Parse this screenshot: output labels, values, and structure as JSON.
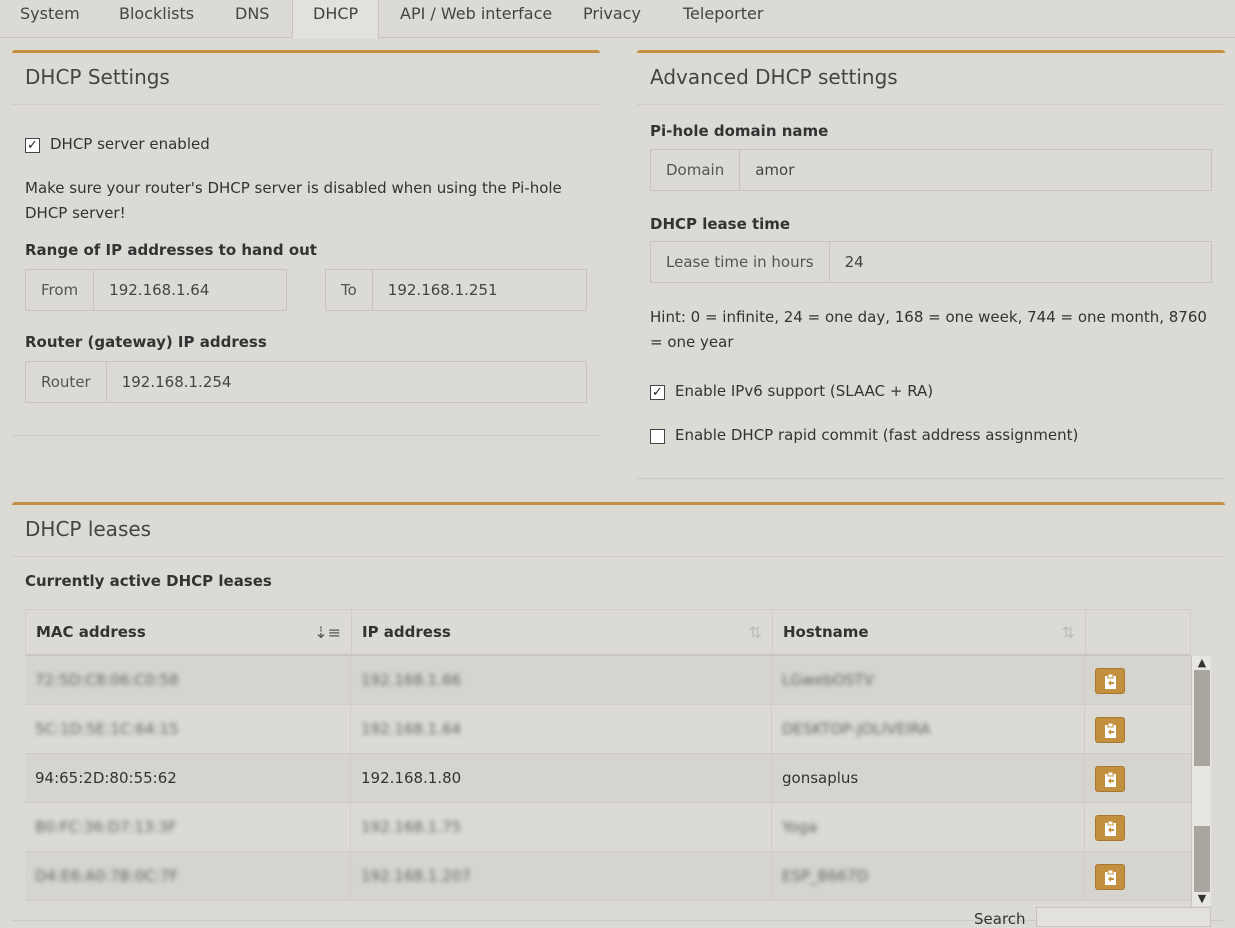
{
  "tabs": [
    "System",
    "Blocklists",
    "DNS",
    "DHCP",
    "API / Web interface",
    "Privacy",
    "Teleporter"
  ],
  "active_tab": "DHCP",
  "dhcp_settings": {
    "title": "DHCP Settings",
    "enabled_label": "DHCP server enabled",
    "enabled": true,
    "warning": "Make sure your router's DHCP server is disabled when using the Pi-hole DHCP server!",
    "range_label": "Range of IP addresses to hand out",
    "from_addon": "From",
    "from_value": "192.168.1.64",
    "to_addon": "To",
    "to_value": "192.168.1.251",
    "router_label": "Router (gateway) IP address",
    "router_addon": "Router",
    "router_value": "192.168.1.254"
  },
  "advanced": {
    "title": "Advanced DHCP settings",
    "domain_label": "Pi-hole domain name",
    "domain_addon": "Domain",
    "domain_value": "amor",
    "lease_label": "DHCP lease time",
    "lease_addon": "Lease time in hours",
    "lease_value": "24",
    "hint": "Hint: 0 = infinite, 24 = one day, 168 = one week, 744 = one month, 8760 = one year",
    "ipv6_label": "Enable IPv6 support (SLAAC + RA)",
    "ipv6_checked": true,
    "rapid_label": "Enable DHCP rapid commit (fast address assignment)",
    "rapid_checked": false
  },
  "leases": {
    "title": "DHCP leases",
    "subtitle": "Currently active DHCP leases",
    "columns": [
      "MAC address",
      "IP address",
      "Hostname"
    ],
    "rows": [
      {
        "mac": "72:5D:C8:06:C0:58",
        "ip": "192.168.1.66",
        "host": "LGwebOSTV",
        "blurred": true
      },
      {
        "mac": "5C:1D:5E:1C:64:15",
        "ip": "192.168.1.64",
        "host": "DESKTOP-JOLIVEIRA",
        "blurred": true
      },
      {
        "mac": "94:65:2D:80:55:62",
        "ip": "192.168.1.80",
        "host": "gonsaplus",
        "blurred": false
      },
      {
        "mac": "B0:FC:36:D7:13:3F",
        "ip": "192.168.1.75",
        "host": "Yoga",
        "blurred": true
      },
      {
        "mac": "D4:E6:A0:7B:0C:7F",
        "ip": "192.168.1.207",
        "host": "ESP_B667D",
        "blurred": true
      }
    ],
    "search_label": "Search"
  }
}
